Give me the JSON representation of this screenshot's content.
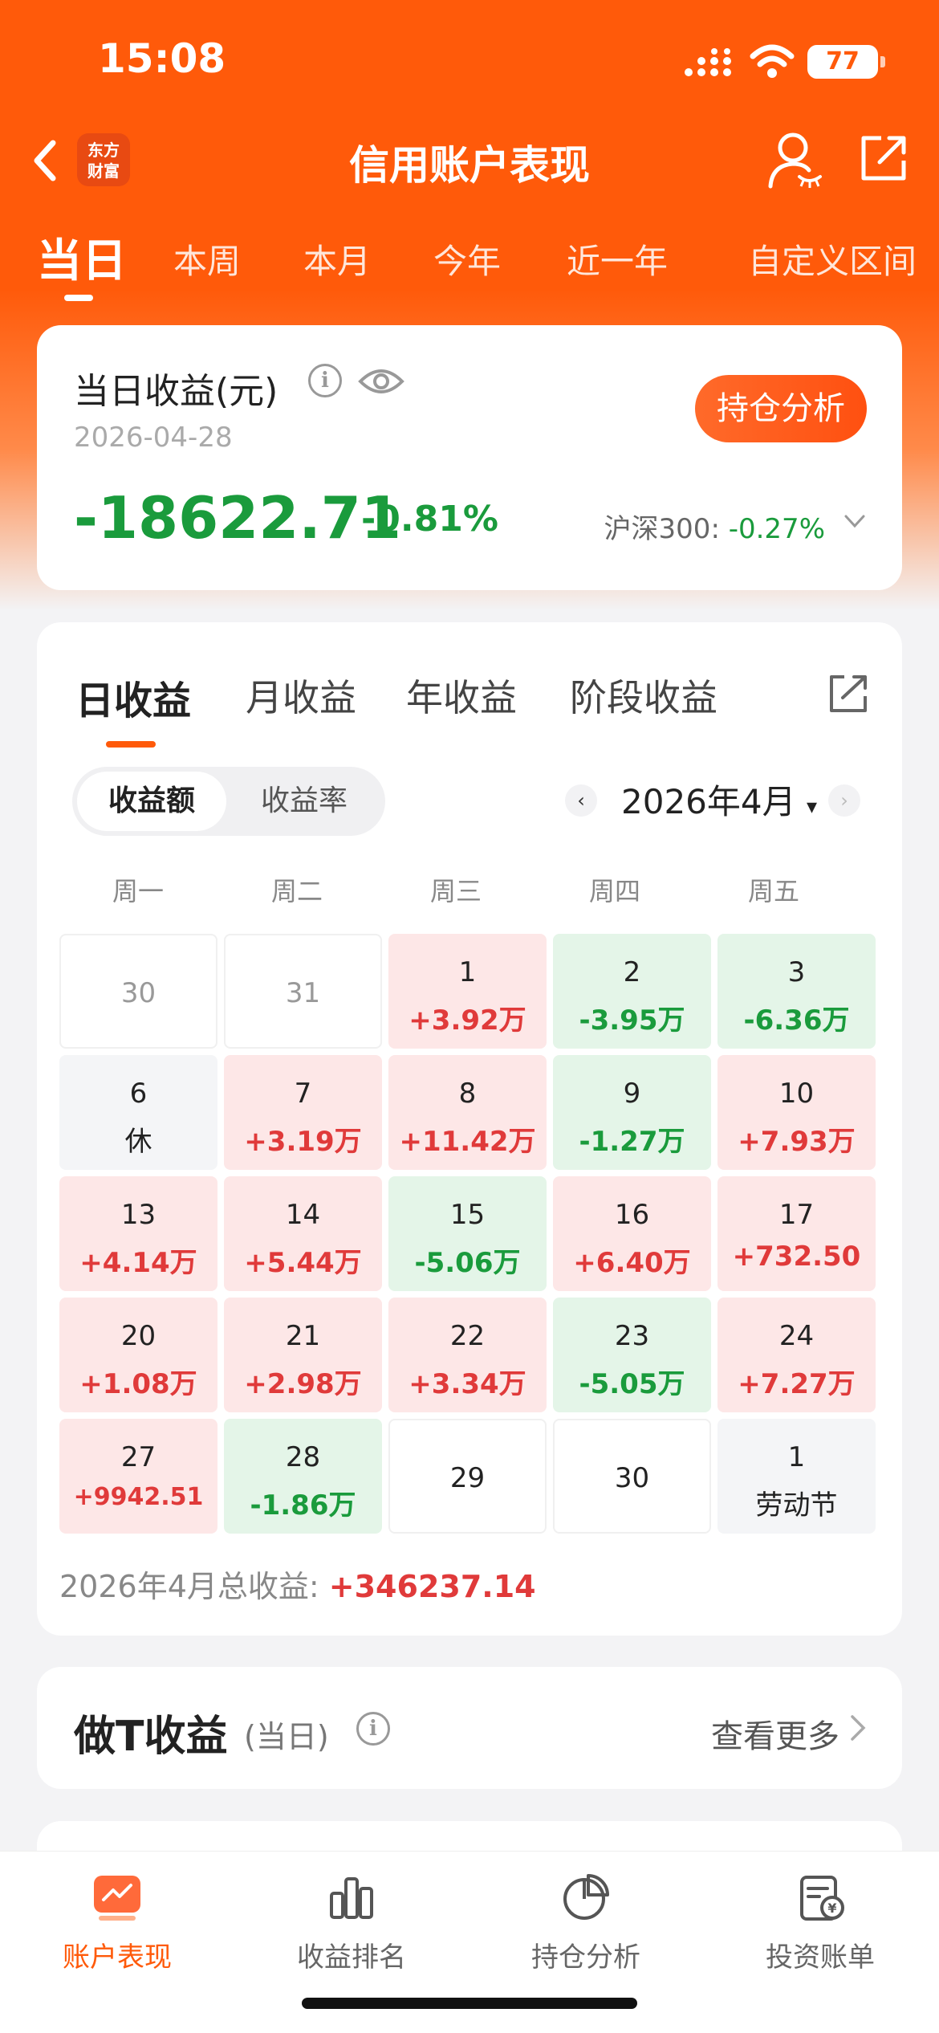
{
  "status": {
    "time": "15:08",
    "battery": "77"
  },
  "nav": {
    "title": "信用账户表现",
    "logo_line1": "东方",
    "logo_line2": "财富"
  },
  "period_tabs": [
    {
      "label": "当日",
      "active": true
    },
    {
      "label": "本周"
    },
    {
      "label": "本月"
    },
    {
      "label": "今年"
    },
    {
      "label": "近一年"
    },
    {
      "label": "自定义区间"
    }
  ],
  "summary": {
    "label": "当日收益(元)",
    "date": "2026-04-28",
    "button": "持仓分析",
    "amount": "-18622.71",
    "percent": "-0.81%",
    "index_label": "沪深300:",
    "index_value": "-0.27%"
  },
  "returns_tabs": [
    "日收益",
    "月收益",
    "年收益",
    "阶段收益"
  ],
  "toggle": {
    "on": "收益额",
    "off": "收益率"
  },
  "month": "2026年4月",
  "weekdays": [
    "周一",
    "周二",
    "周三",
    "周四",
    "周五"
  ],
  "calendar": [
    [
      {
        "day": "30",
        "type": "outside"
      },
      {
        "day": "31",
        "type": "outside"
      },
      {
        "day": "1",
        "val": "+3.92万",
        "type": "pos"
      },
      {
        "day": "2",
        "val": "-3.95万",
        "type": "neg"
      },
      {
        "day": "3",
        "val": "-6.36万",
        "type": "neg"
      }
    ],
    [
      {
        "day": "6",
        "val": "休",
        "type": "gray"
      },
      {
        "day": "7",
        "val": "+3.19万",
        "type": "pos"
      },
      {
        "day": "8",
        "val": "+11.42万",
        "type": "pos"
      },
      {
        "day": "9",
        "val": "-1.27万",
        "type": "neg"
      },
      {
        "day": "10",
        "val": "+7.93万",
        "type": "pos"
      }
    ],
    [
      {
        "day": "13",
        "val": "+4.14万",
        "type": "pos"
      },
      {
        "day": "14",
        "val": "+5.44万",
        "type": "pos"
      },
      {
        "day": "15",
        "val": "-5.06万",
        "type": "neg"
      },
      {
        "day": "16",
        "val": "+6.40万",
        "type": "pos"
      },
      {
        "day": "17",
        "val": "+732.50",
        "type": "pos"
      }
    ],
    [
      {
        "day": "20",
        "val": "+1.08万",
        "type": "pos"
      },
      {
        "day": "21",
        "val": "+2.98万",
        "type": "pos"
      },
      {
        "day": "22",
        "val": "+3.34万",
        "type": "pos"
      },
      {
        "day": "23",
        "val": "-5.05万",
        "type": "neg"
      },
      {
        "day": "24",
        "val": "+7.27万",
        "type": "pos"
      }
    ],
    [
      {
        "day": "27",
        "val": "+9942.51",
        "type": "pos",
        "small": true
      },
      {
        "day": "28",
        "val": "-1.86万",
        "type": "neg"
      },
      {
        "day": "29",
        "type": "empty"
      },
      {
        "day": "30",
        "type": "empty"
      },
      {
        "day": "1",
        "val": "劳动节",
        "type": "gray"
      }
    ]
  ],
  "total": {
    "label": "2026年4月总收益:",
    "value": "+346237.14"
  },
  "t_card": {
    "title": "做T收益",
    "sub": "(当日)",
    "more": "查看更多"
  },
  "tabbar": [
    {
      "label": "账户表现",
      "icon": "chart-trend-icon",
      "active": true
    },
    {
      "label": "收益排名",
      "icon": "bar-chart-icon"
    },
    {
      "label": "持仓分析",
      "icon": "pie-chart-icon"
    },
    {
      "label": "投资账单",
      "icon": "bill-icon"
    }
  ],
  "colors": {
    "brand": "#ff5a0a",
    "gain": "#e03a3a",
    "loss": "#1a9b3c"
  }
}
